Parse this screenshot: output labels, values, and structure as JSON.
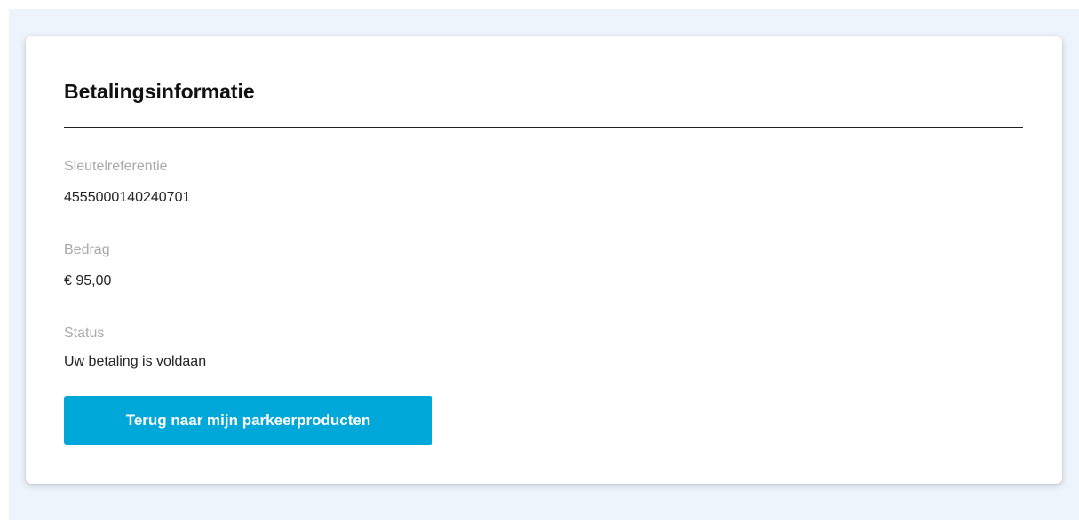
{
  "card": {
    "title": "Betalingsinformatie"
  },
  "fields": [
    {
      "label": "Sleutelreferentie",
      "value": "4555000140240701"
    },
    {
      "label": "Bedrag",
      "value": "€ 95,00"
    },
    {
      "label": "Status",
      "value": "Uw betaling is voldaan"
    }
  ],
  "actions": {
    "back_label": "Terug naar mijn parkeerproducten"
  },
  "colors": {
    "page_background": "#eef4fb",
    "card_background": "#ffffff",
    "label_text": "#a9a9a9",
    "value_text": "#222222",
    "button_background": "#00a7d9",
    "button_text": "#ffffff"
  }
}
